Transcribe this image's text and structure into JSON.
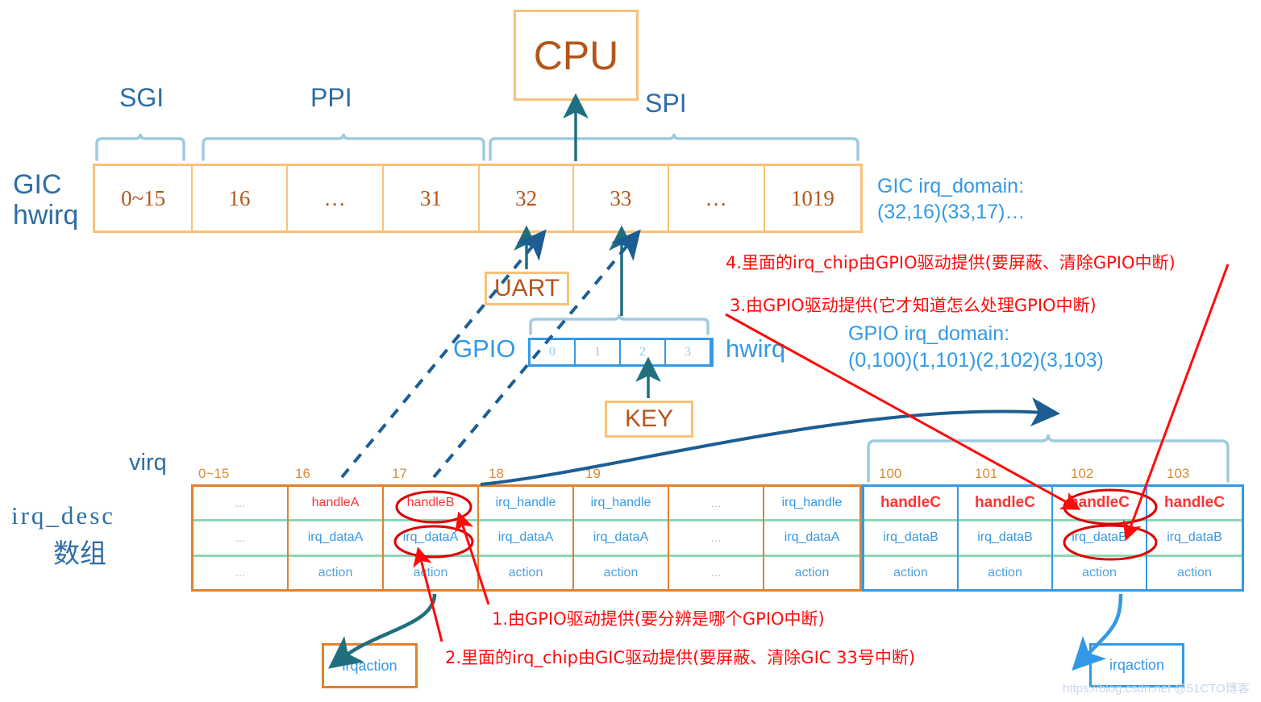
{
  "cpu": {
    "label": "CPU"
  },
  "gic": {
    "row_label": "GIC\nhwirq",
    "row_label_line1": "GIC",
    "row_label_line2": "hwirq",
    "groups": [
      {
        "name": "SGI",
        "span": 1
      },
      {
        "name": "PPI",
        "span": 3
      },
      {
        "name": "SPI",
        "span": 4
      }
    ],
    "cells": [
      "0~15",
      "16",
      "…",
      "31",
      "32",
      "33",
      "…",
      "1019"
    ],
    "domain_line1": "GIC irq_domain:",
    "domain_line2": "(32,16)(33,17)…"
  },
  "uart": {
    "label": "UART"
  },
  "key": {
    "label": "KEY"
  },
  "gpio": {
    "label": "GPIO",
    "hwirq_label": "hwirq",
    "cells": [
      "0",
      "1",
      "2",
      "3"
    ],
    "domain_line1": "GPIO irq_domain:",
    "domain_line2": "(0,100)(1,101)(2,102)(3,103)"
  },
  "irq_desc": {
    "virq_label": "virq",
    "name_label": "irq_desc",
    "name_label_cn": "数组",
    "orange_columns": [
      {
        "header": "0~15",
        "handle": "...",
        "data": "...",
        "action": "..."
      },
      {
        "header": "16",
        "handle": "handleA",
        "data": "irq_dataA",
        "action": "action"
      },
      {
        "header": "17",
        "handle": "handleB",
        "data": "irq_dataA",
        "action": "action"
      },
      {
        "header": "18",
        "handle": "irq_handle",
        "data": "irq_dataA",
        "action": "action"
      },
      {
        "header": "19",
        "handle": "irq_handle",
        "data": "irq_dataA",
        "action": "action"
      },
      {
        "header": "",
        "handle": "...",
        "data": "...",
        "action": "..."
      },
      {
        "header": "",
        "handle": "irq_handle",
        "data": "irq_dataA",
        "action": "action"
      }
    ],
    "blue_columns": [
      {
        "header": "100",
        "handle": "handleC",
        "data": "irq_dataB",
        "action": "action"
      },
      {
        "header": "101",
        "handle": "handleC",
        "data": "irq_dataB",
        "action": "action"
      },
      {
        "header": "102",
        "handle": "handleC",
        "data": "irq_dataB",
        "action": "action"
      },
      {
        "header": "103",
        "handle": "handleC",
        "data": "irq_dataB",
        "action": "action"
      }
    ]
  },
  "irqaction_left": {
    "label": "irqaction"
  },
  "irqaction_right": {
    "label": "irqaction"
  },
  "annotations": {
    "n1": "1.由GPIO驱动提供(要分辨是哪个GPIO中断)",
    "n2": "2.里面的irq_chip由GIC驱动提供(要屏蔽、清除GIC 33号中断)",
    "n3": "3.由GPIO驱动提供(它才知道怎么处理GPIO中断)",
    "n4": "4.里面的irq_chip由GPIO驱动提供(要屏蔽、清除GPIO中断)"
  },
  "watermark": {
    "text": "https://blog.csdn.net @51CTO博客"
  },
  "colors": {
    "orange_light": "#F8C278",
    "orange_dark": "#E0812B",
    "brown": "#B4551A",
    "blue": "#3399E6",
    "dark_blue": "#2E6DA4",
    "teal": "#1F6F7F",
    "green": "#8FD6B4",
    "red": "#FF0A0A"
  }
}
